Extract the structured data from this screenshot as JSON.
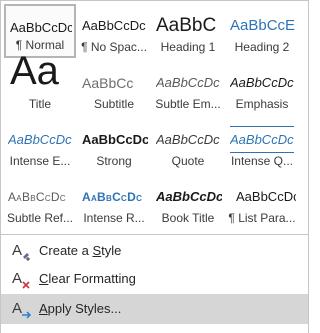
{
  "styles": [
    {
      "label": "¶ Normal",
      "preview": "AaBbCcDc"
    },
    {
      "label": "¶ No Spac...",
      "preview": "AaBbCcDc"
    },
    {
      "label": "Heading 1",
      "preview": "AaBbC"
    },
    {
      "label": "Heading 2",
      "preview": "AaBbCcE"
    },
    {
      "label": "Title",
      "preview": "Aa"
    },
    {
      "label": "Subtitle",
      "preview": "AaBbCc"
    },
    {
      "label": "Subtle Em...",
      "preview": "AaBbCcDc"
    },
    {
      "label": "Emphasis",
      "preview": "AaBbCcDc"
    },
    {
      "label": "Intense E...",
      "preview": "AaBbCcDc"
    },
    {
      "label": "Strong",
      "preview": "AaBbCcDc"
    },
    {
      "label": "Quote",
      "preview": "AaBbCcDc"
    },
    {
      "label": "Intense Q...",
      "preview": "AaBbCcDc"
    },
    {
      "label": "Subtle Ref...",
      "preview": "AaBbCcDc"
    },
    {
      "label": "Intense R...",
      "preview": "AaBbCcDc"
    },
    {
      "label": "Book Title",
      "preview": "AaBbCcDc"
    },
    {
      "label": "¶ List Para...",
      "preview": "AaBbCcDc"
    }
  ],
  "menu": {
    "create_pre": "Create a ",
    "create_key": "S",
    "create_post": "tyle",
    "clear_pre": "",
    "clear_key": "C",
    "clear_post": "lear Formatting",
    "apply_pre": "",
    "apply_key": "A",
    "apply_post": "pply Styles..."
  },
  "colors": {
    "accent_blue": "#2e74b5",
    "hover": "#d6d6d6",
    "icon_purple": "#7b5aa6",
    "icon_red": "#d13438",
    "icon_blue": "#2b7cd3"
  }
}
